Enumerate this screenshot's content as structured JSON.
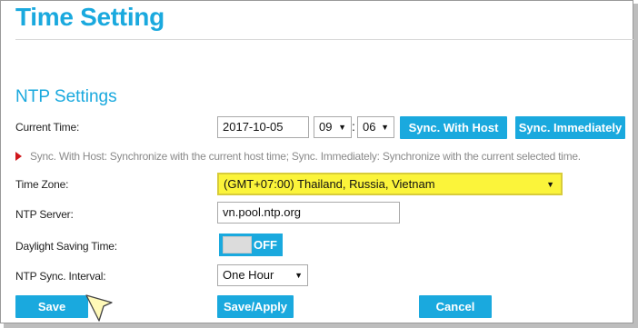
{
  "page": {
    "title": "Time Setting"
  },
  "ntp": {
    "section_title": "NTP Settings",
    "current_time": {
      "label": "Current Time:",
      "date": "2017-10-05",
      "hour": "09",
      "minute": "06",
      "separator": ":",
      "sync_host_label": "Sync. With Host",
      "sync_now_label": "Sync. Immediately"
    },
    "note": "Sync. With Host: Synchronize with the current host time; Sync. Immediately: Synchronize with the current selected time.",
    "time_zone": {
      "label": "Time Zone:",
      "value": "(GMT+07:00) Thailand, Russia, Vietnam"
    },
    "ntp_server": {
      "label": "NTP Server:",
      "value": "vn.pool.ntp.org"
    },
    "dst": {
      "label": "Daylight Saving Time:",
      "state": "OFF"
    },
    "interval": {
      "label": "NTP Sync. Interval:",
      "value": "One Hour"
    }
  },
  "actions": {
    "save": "Save",
    "save_apply": "Save/Apply",
    "cancel": "Cancel"
  },
  "colors": {
    "accent": "#1aa9de",
    "highlight": "#fbf43a",
    "note_marker": "#d0171c"
  }
}
